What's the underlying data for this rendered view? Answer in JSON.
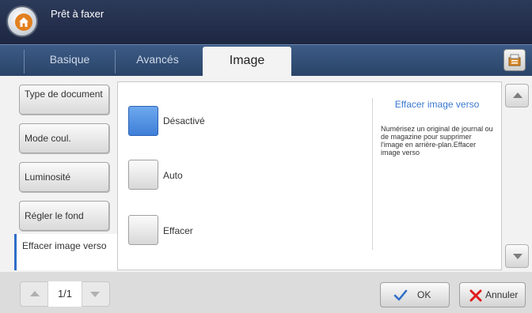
{
  "header": {
    "title": "Prêt à faxer"
  },
  "tabs": [
    {
      "label": "Basique"
    },
    {
      "label": "Avancés"
    },
    {
      "label": "Image"
    }
  ],
  "active_tab": "Image",
  "sidebar": {
    "items": [
      {
        "label": "Type de document"
      },
      {
        "label": "Mode coul."
      },
      {
        "label": "Luminosité"
      },
      {
        "label": "Régler le fond"
      },
      {
        "label": "Effacer image verso"
      }
    ],
    "selected": "Effacer image verso"
  },
  "options": [
    {
      "label": "Désactivé",
      "selected": true
    },
    {
      "label": "Auto",
      "selected": false
    },
    {
      "label": "Effacer",
      "selected": false
    }
  ],
  "help": {
    "title": "Effacer image verso",
    "text": "Numérisez un original de journal ou de magazine pour supprimer l'image en arrière-plan.Effacer image verso"
  },
  "pager": {
    "text": "1/1"
  },
  "footer": {
    "ok_label": "OK",
    "cancel_label": "Annuler"
  },
  "colors": {
    "header": "#1d2742",
    "accent_blue": "#3b78d0",
    "cancel_x": "#e01c1c",
    "ok_check": "#2f6ec8"
  },
  "icons": [
    "home-icon",
    "settings-icon",
    "scroll-up-icon",
    "scroll-down-icon",
    "check-icon",
    "close-icon"
  ]
}
